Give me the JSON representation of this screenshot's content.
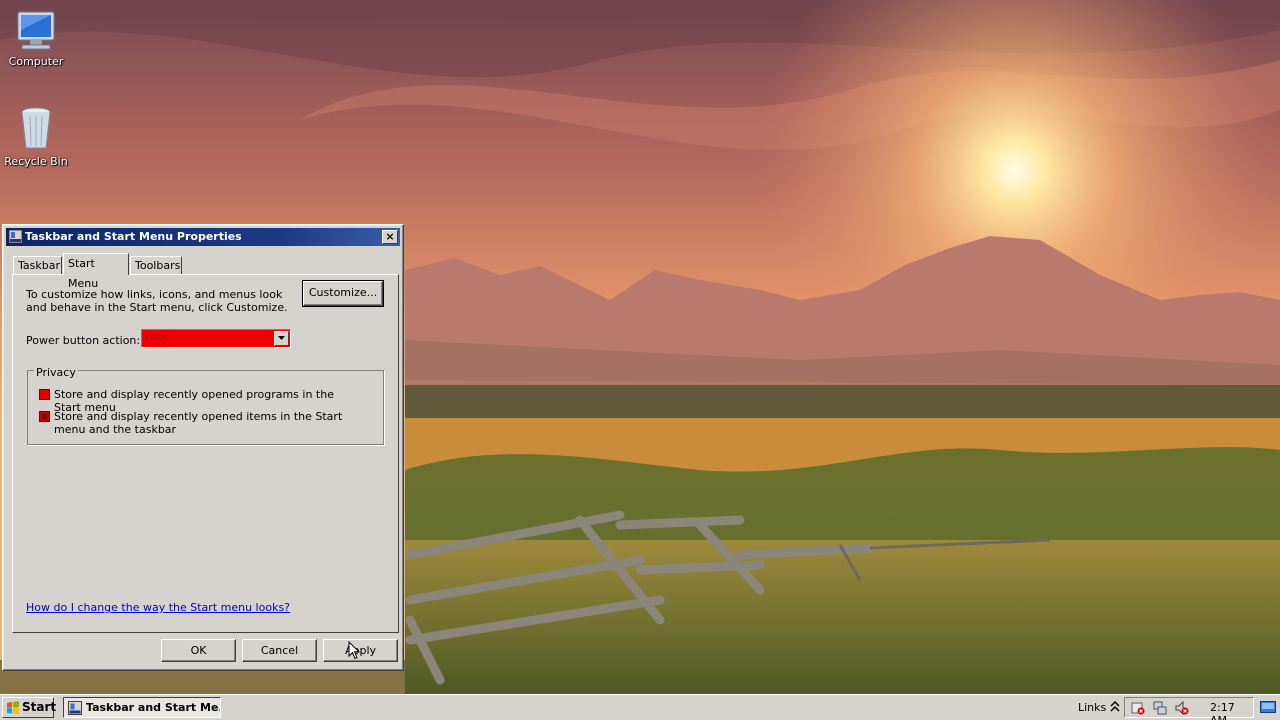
{
  "desktop": {
    "icons": [
      {
        "label": "Computer",
        "icon": "computer-icon"
      },
      {
        "label": "Recycle Bin",
        "icon": "recycle-bin-icon"
      }
    ]
  },
  "dialog": {
    "title": "Taskbar and Start Menu Properties",
    "close_glyph": "×",
    "tabs": [
      {
        "label": "Taskbar",
        "active": false
      },
      {
        "label": "Start Menu",
        "active": true
      },
      {
        "label": "Toolbars",
        "active": false
      }
    ],
    "intro": "To customize how links, icons, and menus look and behave in the Start menu, click Customize.",
    "customize_label": "Customize...",
    "power": {
      "label": "Power button action:",
      "value": "Lock"
    },
    "privacy": {
      "legend": "Privacy",
      "options": [
        {
          "label": "Store and display recently opened programs in the Start menu",
          "checked": false
        },
        {
          "label": "Store and display recently opened items in the Start menu and the taskbar",
          "checked": true
        }
      ]
    },
    "help_link": "How do I change the way the Start menu looks?",
    "buttons": {
      "ok": "OK",
      "cancel": "Cancel",
      "apply": "Apply"
    }
  },
  "taskbar": {
    "start_label": "Start",
    "task_label": "Taskbar and Start Me...",
    "links_label": "Links",
    "clock": "2:17 AM"
  },
  "colors": {
    "title_bar": "#0a246a",
    "face": "#d6d3ce",
    "select_fill": "#f00000",
    "link": "#0000cc"
  }
}
